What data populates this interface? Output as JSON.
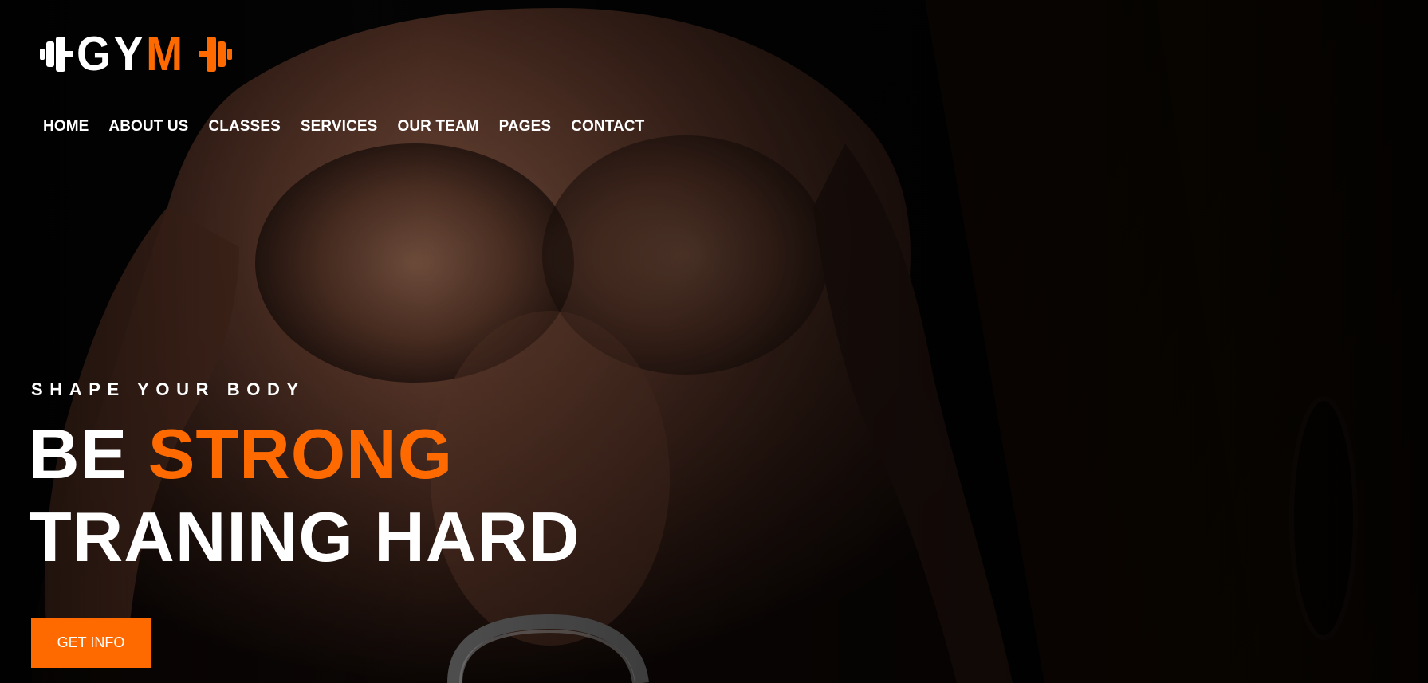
{
  "logo": {
    "text_white": "GY",
    "text_orange": "M"
  },
  "nav": {
    "items": [
      {
        "label": "HOME"
      },
      {
        "label": "ABOUT US"
      },
      {
        "label": "CLASSES"
      },
      {
        "label": "SERVICES"
      },
      {
        "label": "OUR TEAM"
      },
      {
        "label": "PAGES"
      },
      {
        "label": "CONTACT"
      }
    ]
  },
  "hero": {
    "tagline": "SHAPE YOUR BODY",
    "headline_line1_white": "BE",
    "headline_line1_orange": "STRONG",
    "headline_line2": "TRANING HARD",
    "cta_label": "GET INFO"
  },
  "colors": {
    "accent": "#ff6a00",
    "text": "#ffffff",
    "background": "#050505"
  },
  "icons": {
    "logo_left": "dumbbell-white-icon",
    "logo_right": "dumbbell-orange-icon"
  }
}
